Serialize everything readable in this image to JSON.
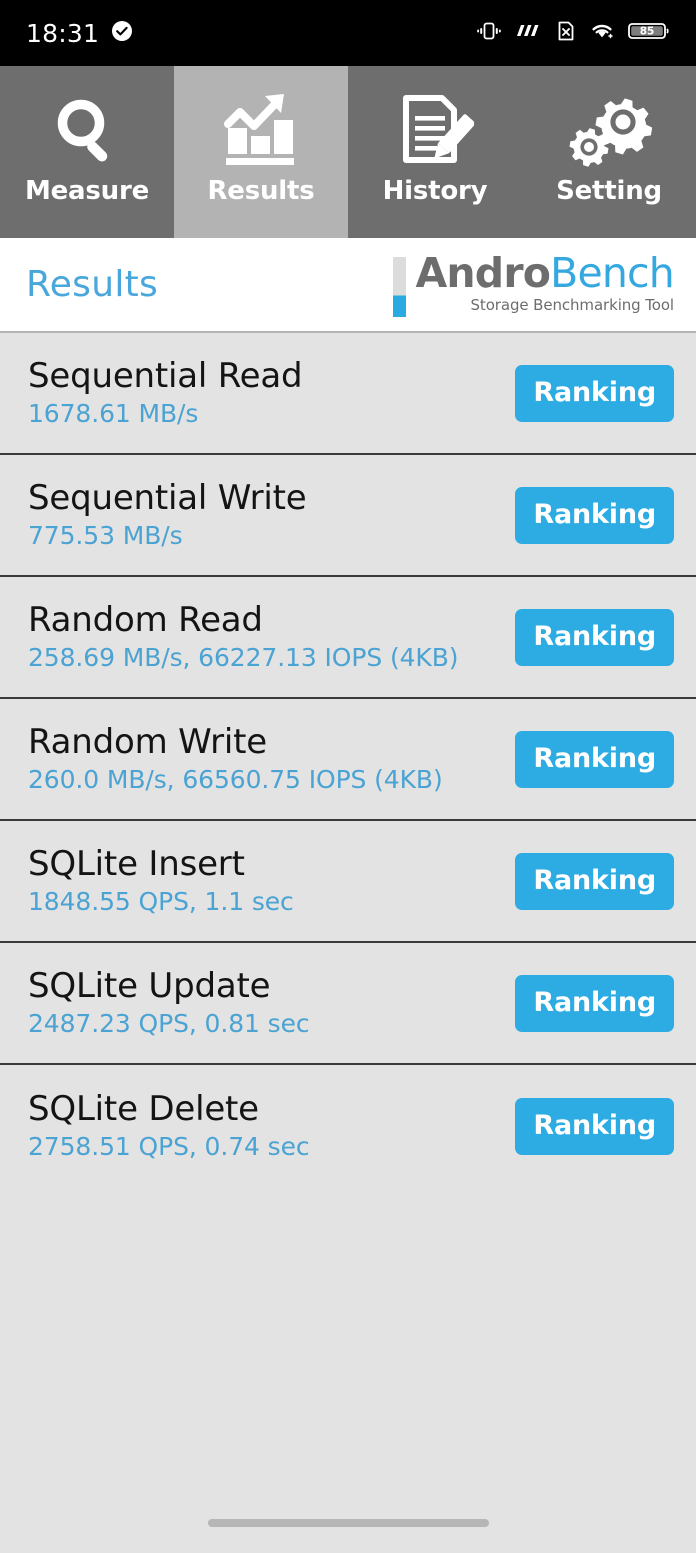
{
  "statusbar": {
    "time": "18:31",
    "icons": [
      {
        "name": "verified-check-icon"
      },
      {
        "name": "vibrate-icon"
      },
      {
        "name": "signal-bars-icon"
      },
      {
        "name": "sim-card-off-icon"
      },
      {
        "name": "wifi-icon"
      },
      {
        "name": "battery-icon"
      }
    ],
    "battery_level": "85"
  },
  "tabs": [
    {
      "label": "Measure",
      "icon": "magnifier-icon",
      "active": false
    },
    {
      "label": "Results",
      "icon": "bar-chart-arrow-icon",
      "active": true
    },
    {
      "label": "History",
      "icon": "document-pencil-icon",
      "active": false
    },
    {
      "label": "Setting",
      "icon": "gears-icon",
      "active": false
    }
  ],
  "header": {
    "title": "Results",
    "logo_primary": "Andro",
    "logo_secondary": "Bench",
    "logo_tagline": "Storage Benchmarking Tool"
  },
  "results": {
    "ranking_label": "Ranking",
    "rows": [
      {
        "title": "Sequential Read",
        "value": "1678.61 MB/s"
      },
      {
        "title": "Sequential Write",
        "value": "775.53 MB/s"
      },
      {
        "title": "Random Read",
        "value": "258.69 MB/s, 66227.13 IOPS (4KB)"
      },
      {
        "title": "Random Write",
        "value": "260.0 MB/s, 66560.75 IOPS (4KB)"
      },
      {
        "title": "SQLite Insert",
        "value": "1848.55 QPS, 1.1 sec"
      },
      {
        "title": "SQLite Update",
        "value": "2487.23 QPS, 0.81 sec"
      },
      {
        "title": "SQLite Delete",
        "value": "2758.51 QPS, 0.74 sec"
      }
    ]
  },
  "colors": {
    "accent_blue": "#2dabe3",
    "value_blue": "#4ba3d3",
    "title_blue": "#4aa7dc",
    "tab_inactive": "#6e6e6e",
    "tab_active": "#b3b3b3",
    "list_bg": "#e3e3e3",
    "divider": "#3a3a3a"
  }
}
